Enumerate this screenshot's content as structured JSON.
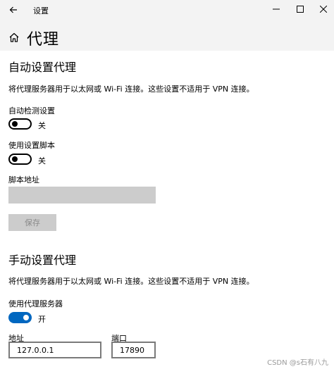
{
  "window": {
    "app_title": "设置",
    "icons": {
      "back": "back-arrow-icon",
      "minimize": "minimize-icon",
      "maximize": "maximize-icon",
      "close": "close-icon"
    }
  },
  "header": {
    "title": "代理",
    "icon": "home-icon"
  },
  "auto_proxy": {
    "section_title": "自动设置代理",
    "description": "将代理服务器用于以太网或 Wi-Fi 连接。这些设置不适用于 VPN 连接。",
    "auto_detect": {
      "label": "自动检测设置",
      "state": "关",
      "on": false
    },
    "use_script": {
      "label": "使用设置脚本",
      "state": "关",
      "on": false
    },
    "script_address": {
      "label": "脚本地址",
      "value": "",
      "disabled": true
    },
    "save_label": "保存"
  },
  "manual_proxy": {
    "section_title": "手动设置代理",
    "description": "将代理服务器用于以太网或 Wi-Fi 连接。这些设置不适用于 VPN 连接。",
    "use_proxy": {
      "label": "使用代理服务器",
      "state": "开",
      "on": true
    },
    "address": {
      "label": "地址",
      "value": "127.0.0.1"
    },
    "port": {
      "label": "端口",
      "value": "17890"
    }
  },
  "colors": {
    "accent": "#0067c0",
    "chrome": "#f3f3f3",
    "disabled": "#cccccc"
  },
  "watermark": "CSDN @s石有八九"
}
